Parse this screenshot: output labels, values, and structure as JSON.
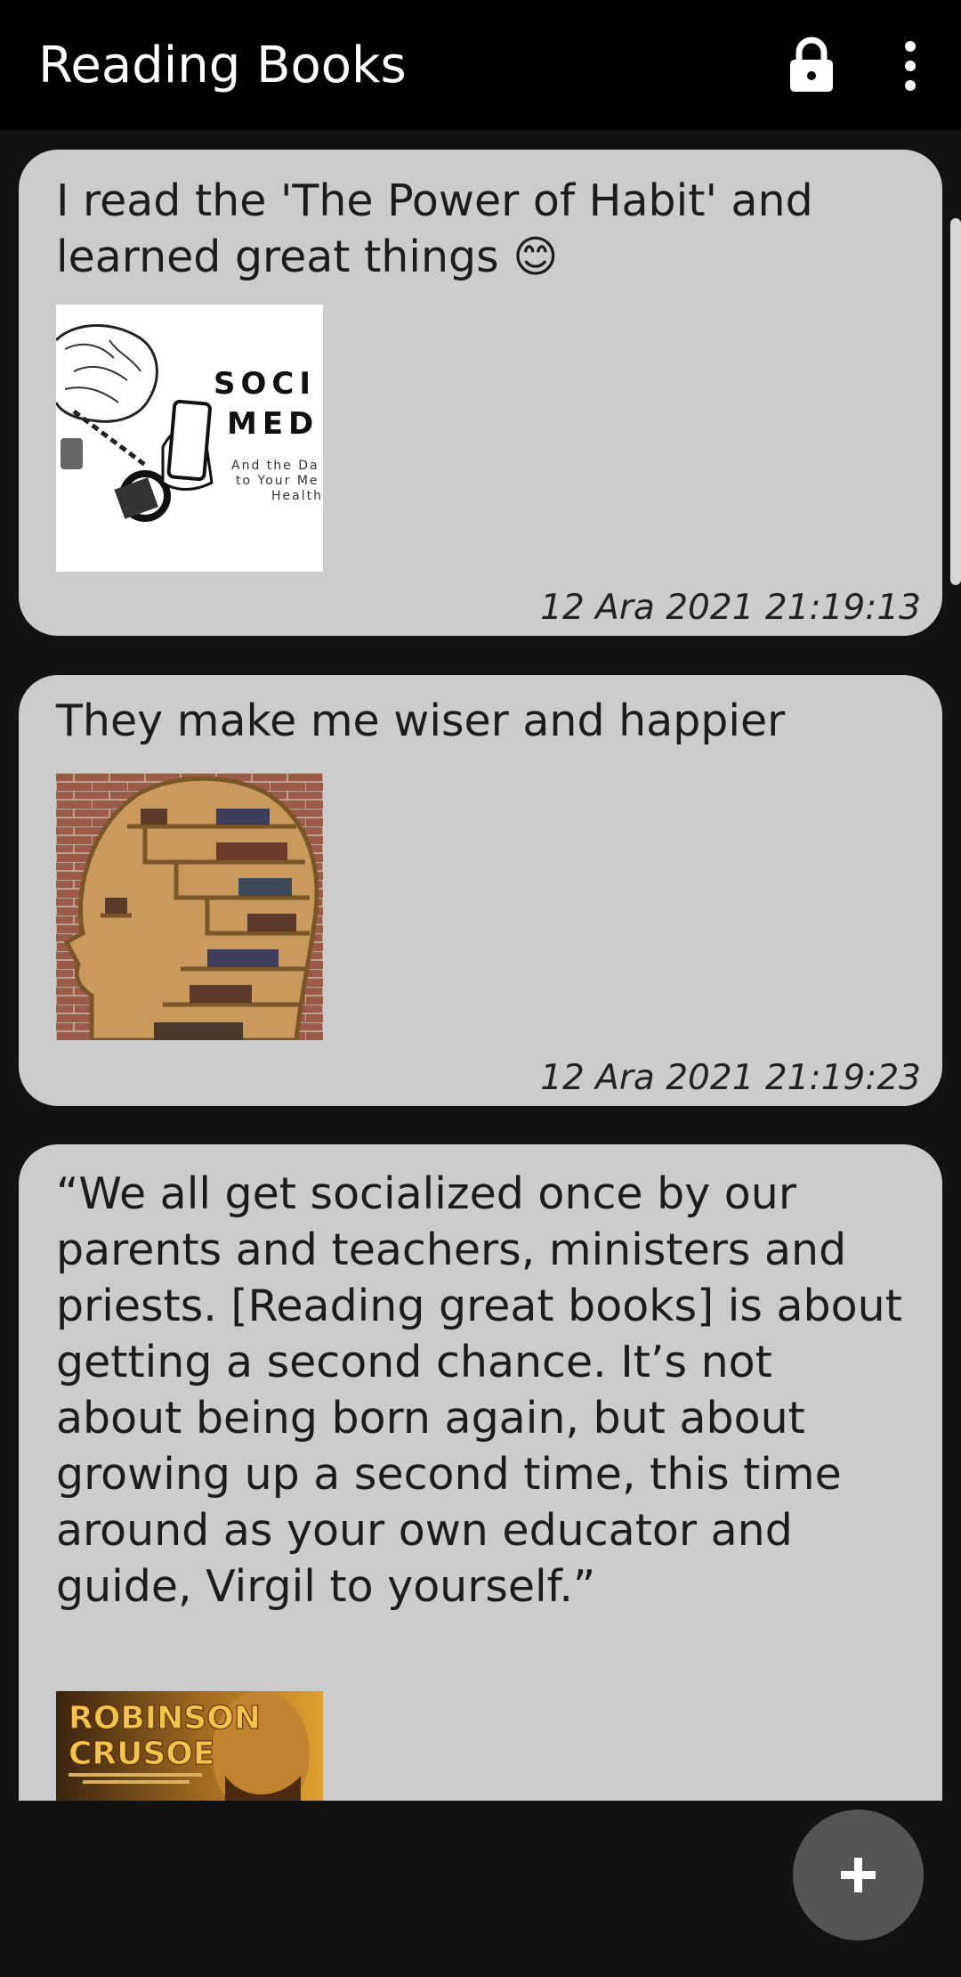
{
  "app": {
    "title": "Reading Books",
    "lock_icon": "lock-icon",
    "more_icon": "more-vert-icon"
  },
  "entries": [
    {
      "text": "I read the 'The Power of Habit' and learned great things 😊",
      "image": "social-media-brain-handcuffed-phone-image",
      "image_text": [
        "SOCI",
        "MED",
        "And the Da",
        "to Your Me",
        "Health"
      ],
      "timestamp": "12 Ara 2021 21:19:13"
    },
    {
      "text": "They make me wiser and happier",
      "image": "head-shaped-bookshelf-image",
      "timestamp": "12 Ara 2021 21:19:23"
    },
    {
      "text": "“We all get socialized once by our parents and teachers, ministers and priests. [Reading great books] is about getting a second chance. It’s not about being born again, but about growing up a second time, this time around as your own educator and guide, Virgil to yourself.”",
      "image": "robinson-crusoe-book-cover-image",
      "image_text": [
        "ROBINSON",
        "CRUSOE"
      ]
    }
  ],
  "fab": {
    "icon": "plus-icon"
  },
  "colors": {
    "appbar": "#000000",
    "background": "#121212",
    "card": "#cccccc",
    "fab": "#555555"
  }
}
